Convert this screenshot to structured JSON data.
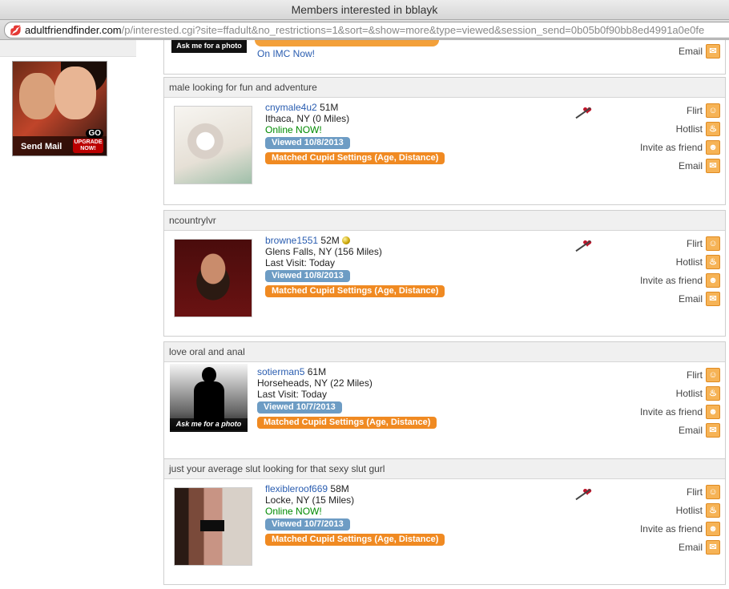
{
  "window": {
    "title": "Members interested in bblayk"
  },
  "urlbar": {
    "domain": "adultfriendfinder.com",
    "path": "/p/interested.cgi?site=ffadult&no_restrictions=1&sort=&show=more&type=viewed&session_send=0b05b0f90bb8ed4991a0e0fe"
  },
  "ad": {
    "send_mail": "Send Mail",
    "go": "GO",
    "upgrade": "UPGRADE NOW!"
  },
  "top_partial": {
    "photo_caption": "Ask me for a photo",
    "status": "On IMC Now!",
    "email": "Email"
  },
  "actions": {
    "flirt": "Flirt",
    "hotlist": "Hotlist",
    "invite": "Invite as friend",
    "email": "Email"
  },
  "cards": [
    {
      "headline": "male looking for fun and adventure",
      "username": "cnymale4u2",
      "age_gender": "51M",
      "location": "Ithaca, NY  (0 Miles)",
      "status": "Online NOW!",
      "viewed": "Viewed 10/8/2013",
      "cupid": "Matched Cupid Settings (Age, Distance)"
    },
    {
      "headline": "ncountrylvr",
      "username": "browne1551",
      "age_gender": "52M",
      "location": "Glens Falls, NY  (156 Miles)",
      "status": "Last Visit: Today",
      "viewed": "Viewed 10/8/2013",
      "cupid": "Matched Cupid Settings (Age, Distance)"
    },
    {
      "headline": "love oral and anal",
      "username": "sotierman5",
      "age_gender": "61M",
      "location": "Horseheads, NY  (22 Miles)",
      "status": "Last Visit: Today",
      "viewed": "Viewed 10/7/2013",
      "cupid": "Matched Cupid Settings (Age, Distance)",
      "photo_caption": "Ask me for a photo"
    },
    {
      "headline": "just your average slut looking for that sexy slut gurl",
      "username": "flexibleroof669",
      "age_gender": "58M",
      "location": "Locke, NY  (15 Miles)",
      "status": "Online NOW!",
      "viewed": "Viewed 10/7/2013",
      "cupid": "Matched Cupid Settings (Age, Distance)"
    }
  ]
}
